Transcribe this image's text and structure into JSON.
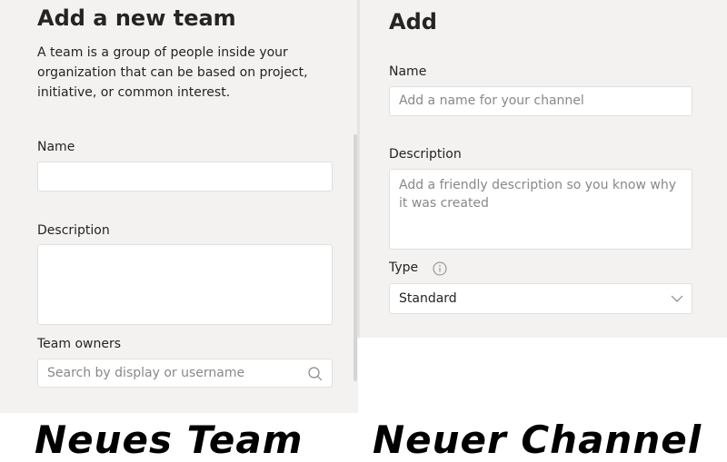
{
  "left_panel": {
    "title": "Add a new team",
    "intro": "A team is a group of people inside your organization that can be based on project, initiative, or common interest.",
    "name_label": "Name",
    "name_value": "",
    "description_label": "Description",
    "description_value": "",
    "owners_label": "Team owners",
    "owners_placeholder": "Search by display or username",
    "owners_icon": "search-icon"
  },
  "right_panel": {
    "title": "Add",
    "name_label": "Name",
    "name_placeholder": "Add a name for your channel",
    "description_label": "Description",
    "description_placeholder": "Add a friendly description so you know why it was created",
    "type_label": "Type",
    "type_icon": "info-icon",
    "type_value": "Standard",
    "type_dropdown_icon": "chevron-down-icon"
  },
  "captions": {
    "left": "Neues Team",
    "right": "Neuer Channel"
  }
}
